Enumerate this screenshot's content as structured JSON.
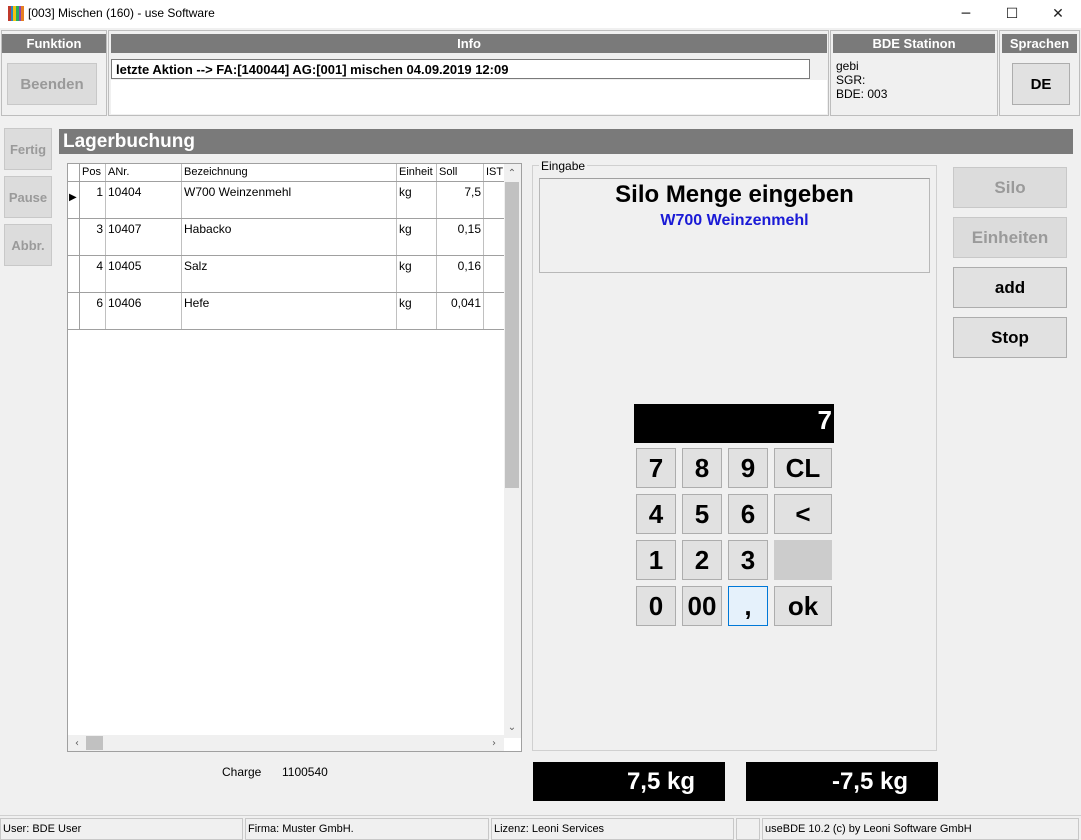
{
  "window": {
    "title": "[003] Mischen (160) - use Software",
    "icon_colors": [
      "#c0392b",
      "#2e86c1",
      "#f1c40f",
      "#27ae60",
      "#8e44ad",
      "#e67e22"
    ],
    "minimize_glyph": "─",
    "maximize_glyph": "☐",
    "close_glyph": "✕"
  },
  "funktion": {
    "header": "Funktion",
    "beenden_label": "Beenden"
  },
  "info": {
    "header": "Info",
    "line": "letzte Aktion --> FA:[140044] AG:[001] mischen 04.09.2019 12:09"
  },
  "station": {
    "header": "BDE Statinon",
    "lines": [
      "gebi",
      "SGR:",
      "BDE: 003"
    ]
  },
  "sprachen": {
    "header": "Sprachen",
    "lang_label": "DE"
  },
  "side_buttons": {
    "fertig": "Fertig",
    "pause": "Pause",
    "abbr": "Abbr."
  },
  "section_title": "Lagerbuchung",
  "grid": {
    "columns": [
      "Pos",
      "ANr.",
      "Bezeichnung",
      "Einheit",
      "Soll",
      "IST"
    ],
    "rows": [
      {
        "pos": "1",
        "anr": "10404",
        "bez": "W700 Weinzenmehl",
        "einheit": "kg",
        "soll": "7,5",
        "ist": ""
      },
      {
        "pos": "3",
        "anr": "10407",
        "bez": "Habacko",
        "einheit": "kg",
        "soll": "0,15",
        "ist": ""
      },
      {
        "pos": "4",
        "anr": "10405",
        "bez": "Salz",
        "einheit": "kg",
        "soll": "0,16",
        "ist": ""
      },
      {
        "pos": "6",
        "anr": "10406",
        "bez": "Hefe",
        "einheit": "kg",
        "soll": "0,041",
        "ist": ""
      }
    ],
    "current_row_glyph": "▶"
  },
  "charge": {
    "label": "Charge",
    "value": "1100540"
  },
  "eingabe": {
    "label": "Eingabe",
    "title": "Silo Menge eingeben",
    "subtitle": "W700 Weinzenmehl",
    "display_value": "7",
    "accent_color": "#1a1ad6"
  },
  "keypad": {
    "k7": "7",
    "k8": "8",
    "k9": "9",
    "cl": "CL",
    "k4": "4",
    "k5": "5",
    "k6": "6",
    "back": "<",
    "k1": "1",
    "k2": "2",
    "k3": "3",
    "k0": "0",
    "k00": "00",
    "comma": ",",
    "ok": "ok"
  },
  "right_buttons": {
    "silo": "Silo",
    "einheiten": "Einheiten",
    "add": "add",
    "stop": "Stop"
  },
  "totals": {
    "ist": "7,5 kg",
    "diff": "-7,5 kg"
  },
  "status": {
    "user": "User: BDE User",
    "firma": "Firma: Muster GmbH.",
    "lizenz": "Lizenz: Leoni Services",
    "empty": "",
    "version": "useBDE 10.2 (c) by Leoni Software GmbH"
  }
}
